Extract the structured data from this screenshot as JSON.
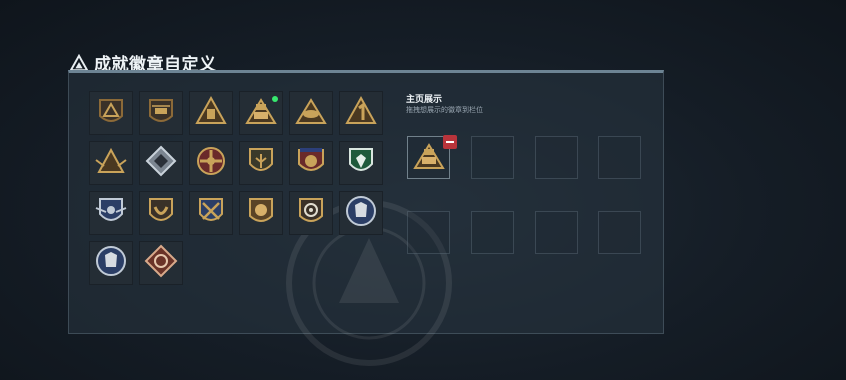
{
  "header": {
    "title": "成就徽章自定义",
    "icon": "triangle-emblem-icon"
  },
  "display": {
    "title": "主页展示",
    "hint": "拖拽想展示的徽章到栏位"
  },
  "badges": [
    {
      "icon": "shield-triangle-badge-icon"
    },
    {
      "icon": "helicopter-badge-icon"
    },
    {
      "icon": "tower-triangle-badge-icon"
    },
    {
      "icon": "outpost-triangle-badge-icon",
      "new": true
    },
    {
      "icon": "hat-triangle-badge-icon"
    },
    {
      "icon": "number-one-badge-icon"
    },
    {
      "icon": "winged-triangle-badge-icon"
    },
    {
      "icon": "diamond-badge-icon"
    },
    {
      "icon": "medal-cross-badge-icon"
    },
    {
      "icon": "plant-shield-badge-icon"
    },
    {
      "icon": "star-shield-badge-icon"
    },
    {
      "icon": "green-shield-badge-icon"
    },
    {
      "icon": "blue-wing-shield-badge-icon"
    },
    {
      "icon": "horn-shield-badge-icon"
    },
    {
      "icon": "crossed-rifles-badge-icon"
    },
    {
      "icon": "lion-badge-icon"
    },
    {
      "icon": "target-shield-badge-icon"
    },
    {
      "icon": "wolf-circle-badge-icon"
    },
    {
      "icon": "wolf-circle-badge-2-icon"
    },
    {
      "icon": "compass-diamond-badge-icon"
    }
  ],
  "slots": [
    {
      "filled": true,
      "icon": "outpost-triangle-badge-icon"
    },
    {
      "filled": false
    },
    {
      "filled": false
    },
    {
      "filled": false
    },
    {
      "filled": false
    },
    {
      "filled": false
    },
    {
      "filled": false
    },
    {
      "filled": false
    }
  ],
  "colors": {
    "gold": "#c9a35a",
    "bronze": "#8c6a38",
    "red": "#b8343b",
    "new_dot": "#37e86e"
  }
}
